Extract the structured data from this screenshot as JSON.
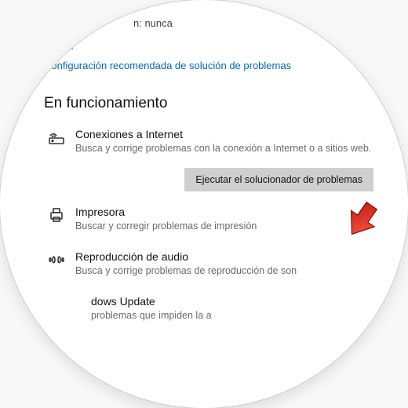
{
  "topFragment": "n: nunca",
  "links": {
    "history": "istorial",
    "recommended": "Configuración recomendada de solución de problemas"
  },
  "section": {
    "heading": "En funcionamiento",
    "items": [
      {
        "icon": "wifi-router-icon",
        "title": "Conexiones a Internet",
        "desc": "Busca y corrige problemas con la conexión a Internet o a sitios web."
      },
      {
        "icon": "printer-icon",
        "title": "Impresora",
        "desc": "Buscar y corregir problemas de impresión"
      },
      {
        "icon": "audio-icon",
        "title": "Reproducción de audio",
        "desc": "Busca y corrige problemas de reproducción de son"
      },
      {
        "icon": "update-icon",
        "title": "dows Update",
        "desc": "problemas que impiden la a"
      }
    ],
    "runButton": "Ejecutar el solucionador de problemas"
  }
}
